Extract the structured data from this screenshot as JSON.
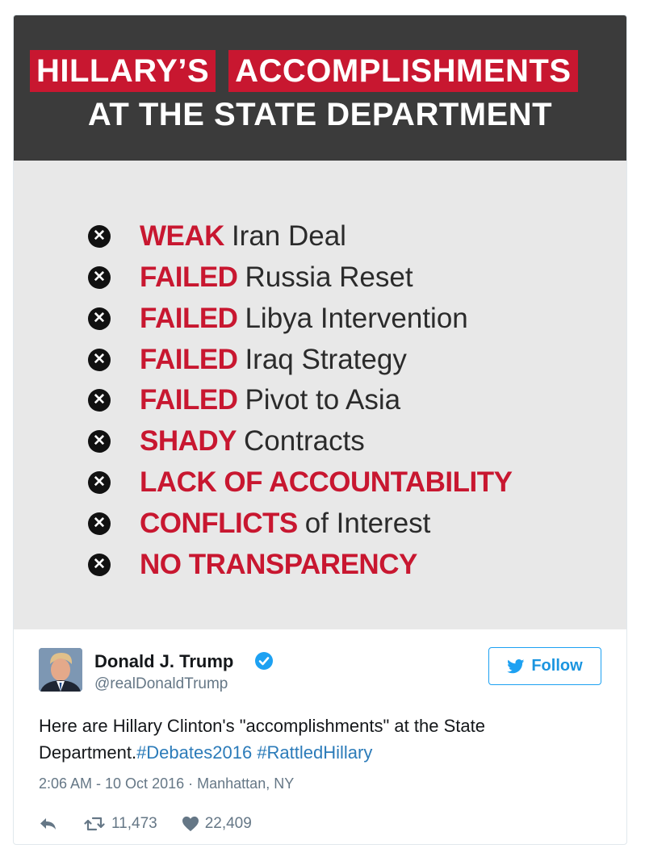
{
  "banner": {
    "word1": "HILLARY’S",
    "word2": "ACCOMPLISHMENTS",
    "line2": "AT THE STATE DEPARTMENT"
  },
  "items": [
    {
      "keyword": "WEAK",
      "rest": "Iran Deal"
    },
    {
      "keyword": "FAILED",
      "rest": "Russia Reset"
    },
    {
      "keyword": "FAILED",
      "rest": "Libya Intervention"
    },
    {
      "keyword": "FAILED",
      "rest": "Iraq Strategy"
    },
    {
      "keyword": "FAILED",
      "rest": "Pivot to Asia"
    },
    {
      "keyword": "SHADY",
      "rest": "Contracts"
    },
    {
      "keyword": "LACK OF ACCOUNTABILITY",
      "rest": ""
    },
    {
      "keyword": "CONFLICTS",
      "rest": "of Interest"
    },
    {
      "keyword": "NO TRANSPARENCY",
      "rest": ""
    }
  ],
  "tweet": {
    "name": "Donald J. Trump",
    "handle": "@realDonaldTrump",
    "follow_label": "Follow",
    "text_main": "Here are Hillary Clinton's \"accomplishments\" at the State Department.",
    "hashtag1": "#Debates2016",
    "hashtag2": "#RattledHillary",
    "timestamp": "2:06 AM - 10 Oct 2016",
    "separator": "·",
    "location": "Manhattan, NY",
    "retweets": "11,473",
    "likes": "22,409"
  },
  "colors": {
    "accent_red": "#c81730",
    "banner_bg": "#3b3b3b",
    "list_bg": "#e8e8e8",
    "twitter_blue": "#1da1f2",
    "link_blue": "#2b7bb9"
  },
  "icons": [
    "x-circle-icon",
    "verified-badge-icon",
    "twitter-bird-icon",
    "reply-icon",
    "retweet-icon",
    "heart-icon"
  ]
}
